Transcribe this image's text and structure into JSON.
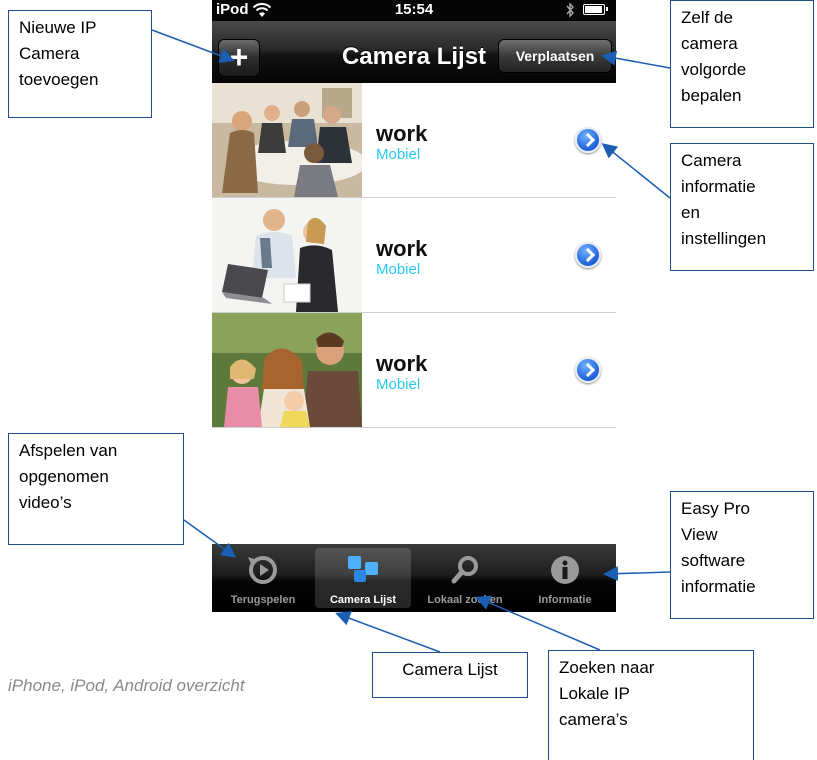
{
  "statusbar": {
    "carrier": "iPod",
    "time": "15:54"
  },
  "navbar": {
    "title": "Camera Lijst",
    "add_label": "+",
    "move_label": "Verplaatsen"
  },
  "cameras": [
    {
      "name": "work",
      "type": "Mobiel"
    },
    {
      "name": "work",
      "type": "Mobiel"
    },
    {
      "name": "work",
      "type": "Mobiel"
    }
  ],
  "tabbar": {
    "tabs": [
      {
        "label": "Terugspelen",
        "icon": "replay-icon",
        "active": false
      },
      {
        "label": "Camera Lijst",
        "icon": "camera-list-icon",
        "active": true
      },
      {
        "label": "Lokaal zoeken",
        "icon": "search-icon",
        "active": false
      },
      {
        "label": "Informatie",
        "icon": "info-icon",
        "active": false
      }
    ]
  },
  "callouts": {
    "add_camera": "Nieuwe IP\nCamera\ntoevoegen",
    "reorder": "Zelf de\ncamera\nvolgorde\nbepalen",
    "camera_info": "Camera\ninformatie\nen\ninstellingen",
    "playback": "Afspelen van\nopgenomen\nvideo’s",
    "software_info": "Easy Pro\nView\nsoftware\ninformatie",
    "camera_list": "Camera Lijst",
    "local_search": "Zoeken naar\nLokale IP\ncamera’s"
  },
  "caption": "iPhone, iPod, Android overzicht",
  "colors": {
    "accent": "#28c8f0",
    "callout_border": "#1f4e8c",
    "arrow": "#1a5fb4"
  }
}
